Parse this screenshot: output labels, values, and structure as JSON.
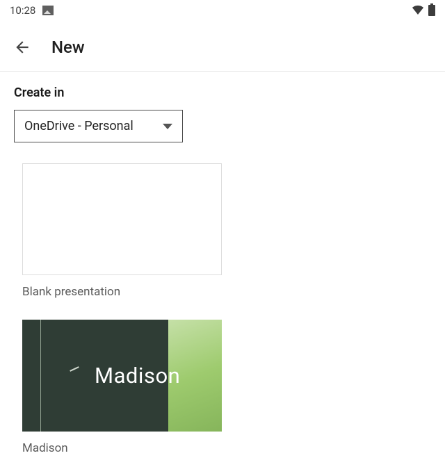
{
  "status": {
    "time": "10:28"
  },
  "header": {
    "title": "New"
  },
  "create": {
    "label": "Create in",
    "selected": "OneDrive - Personal"
  },
  "templates": [
    {
      "name": "Blank presentation",
      "preview_text": ""
    },
    {
      "name": "Madison",
      "preview_text": "Madison"
    }
  ]
}
